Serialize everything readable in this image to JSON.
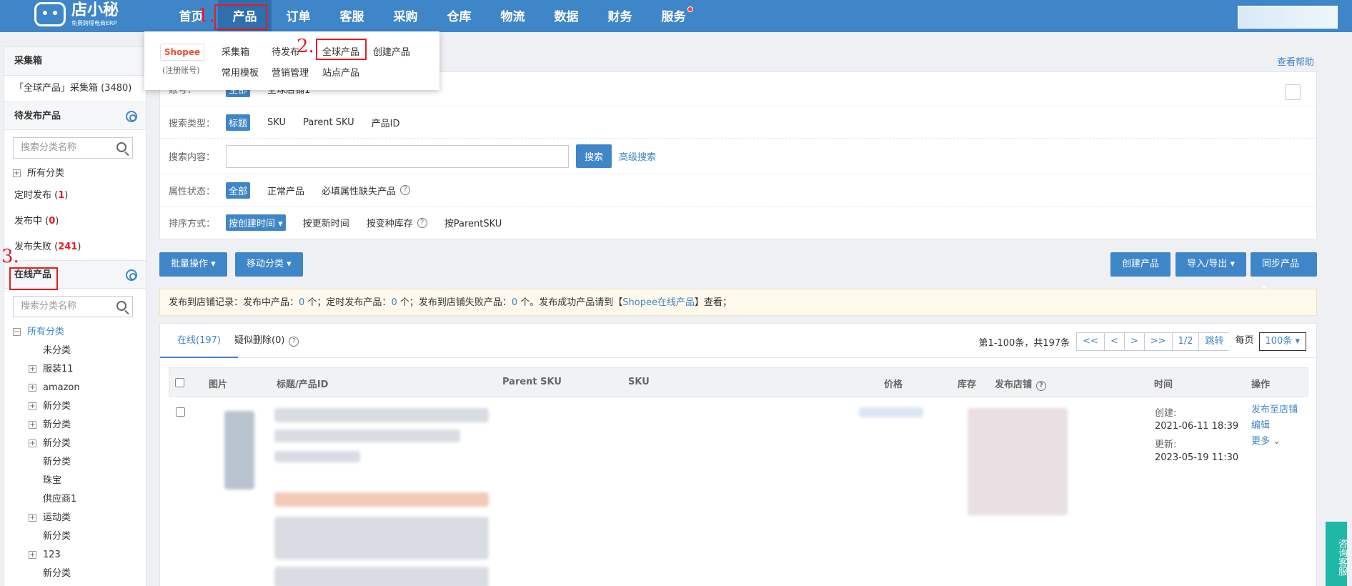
{
  "app": {
    "logo_name": "店小秘",
    "logo_sub": "免费跨境电商ERP"
  },
  "nav": [
    {
      "label": "首页"
    },
    {
      "label": "产品"
    },
    {
      "label": "订单"
    },
    {
      "label": "客服"
    },
    {
      "label": "采购"
    },
    {
      "label": "仓库"
    },
    {
      "label": "物流"
    },
    {
      "label": "数据"
    },
    {
      "label": "财务"
    },
    {
      "label": "服务"
    }
  ],
  "annotations": {
    "step1": "1.",
    "step2": "2.",
    "step3": "3."
  },
  "dropdown": {
    "shopee": "Shopee",
    "shopee_note": "(注册账号)",
    "items": [
      "采集箱",
      "待发布",
      "全球产品",
      "创建产品",
      "常用模板",
      "营销管理",
      "站点产品"
    ]
  },
  "sidebar": {
    "collect_title": "采集箱",
    "collect_item": "「全球产品」采集箱 (3480)",
    "pending_title": "待发布产品",
    "search_placeholder": "搜索分类名称",
    "all_category": "所有分类",
    "scheduled": "定时发布 (",
    "scheduled_count": "1",
    "publishing": "发布中 (",
    "publishing_count": "0",
    "failed": "发布失败 (",
    "failed_count": "241",
    "close_paren": ")",
    "online_title": "在线产品",
    "tree": [
      "所有分类",
      "未分类",
      "服装11",
      "amazon",
      "新分类",
      "新分类",
      "新分类",
      "新分类",
      "珠宝",
      "供应商1",
      "运动类",
      "新分类",
      "123",
      "新分类"
    ]
  },
  "help_link": "查看帮助",
  "filters": {
    "account_label": "账号：",
    "account_all": "全部",
    "account_store": "全球店铺1",
    "type_label": "搜索类型：",
    "types": [
      "标题",
      "SKU",
      "Parent SKU",
      "产品ID"
    ],
    "content_label": "搜索内容：",
    "search_btn": "搜索",
    "advanced": "高级搜索",
    "attr_label": "属性状态：",
    "attrs": [
      "全部",
      "正常产品",
      "必填属性缺失产品"
    ],
    "sort_label": "排序方式：",
    "sorts": [
      "按创建时间",
      "按更新时间",
      "按变种库存",
      "按ParentSKU"
    ]
  },
  "toolbar": {
    "batch": "批量操作",
    "move": "移动分类",
    "create": "创建产品",
    "import": "导入/导出",
    "sync": "同步产品"
  },
  "notice": {
    "t1": "发布到店铺记录：发布中产品：",
    "v1": "0",
    "t2": " 个；定时发布产品：",
    "v2": "0",
    "t3": " 个；发布到店铺失败产品：",
    "v3": "0",
    "t4": " 个。发布成功产品请到【",
    "link": "Shopee在线产品",
    "t5": "】查看；"
  },
  "tabs": {
    "online": "在线(197)",
    "deleted": "疑似删除(0)"
  },
  "pager": {
    "info": "第1-100条，共197条",
    "first": "<<",
    "prev": "<",
    "next": ">",
    "last": ">>",
    "page": "1/2",
    "jump": "跳转",
    "per_label": "每页",
    "per": "100条"
  },
  "table": {
    "headers": [
      "图片",
      "标题/产品ID",
      "Parent SKU",
      "SKU",
      "价格",
      "库存",
      "发布店铺",
      "时间",
      "操作"
    ],
    "row": {
      "created_label": "创建:",
      "created": "2021-06-11 18:39",
      "updated_label": "更新:",
      "updated": "2023-05-19 11:30",
      "ops": [
        "发布至店铺",
        "编辑",
        "更多"
      ]
    }
  },
  "consult": "咨询客服"
}
